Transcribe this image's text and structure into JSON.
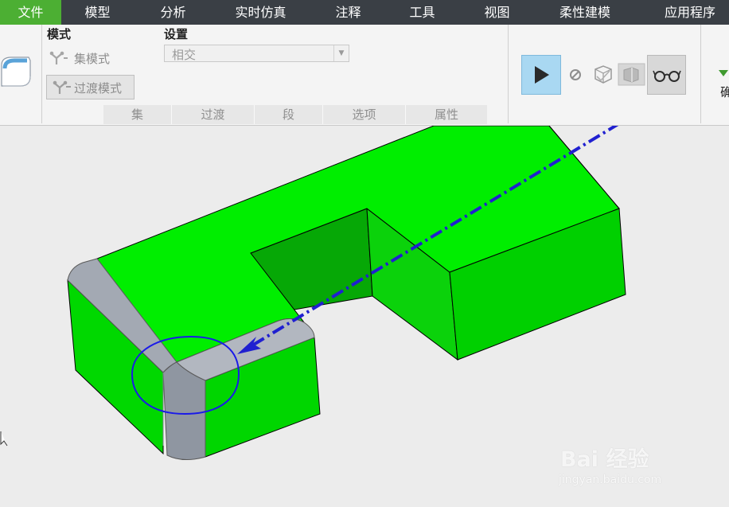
{
  "menu": [
    {
      "label": "文件",
      "active": true
    },
    {
      "label": "模型"
    },
    {
      "label": "分析"
    },
    {
      "label": "实时仿真"
    },
    {
      "label": "注释"
    },
    {
      "label": "工具"
    },
    {
      "label": "视图"
    },
    {
      "label": "柔性建模"
    },
    {
      "label": "应用程序"
    }
  ],
  "ribbon": {
    "mode_heading": "模式",
    "settings_heading": "设置",
    "set_mode_label": "集模式",
    "transition_mode_label": "过渡模式",
    "settings_value": "相交",
    "tabs": [
      "集",
      "过渡",
      "段",
      "选项",
      "属性"
    ],
    "right_truncated_label": "确"
  },
  "watermark": {
    "brand": "Bai 经验",
    "url": "jingyan.baidu.com"
  },
  "colors": {
    "menu_bg": "#3a3f45",
    "active_menu": "#4caf33",
    "model_face": "#00ee00",
    "fillet_grey": "#9ea4ae",
    "arrow": "#1010d0",
    "play_button_bg": "#a9d8f2"
  }
}
